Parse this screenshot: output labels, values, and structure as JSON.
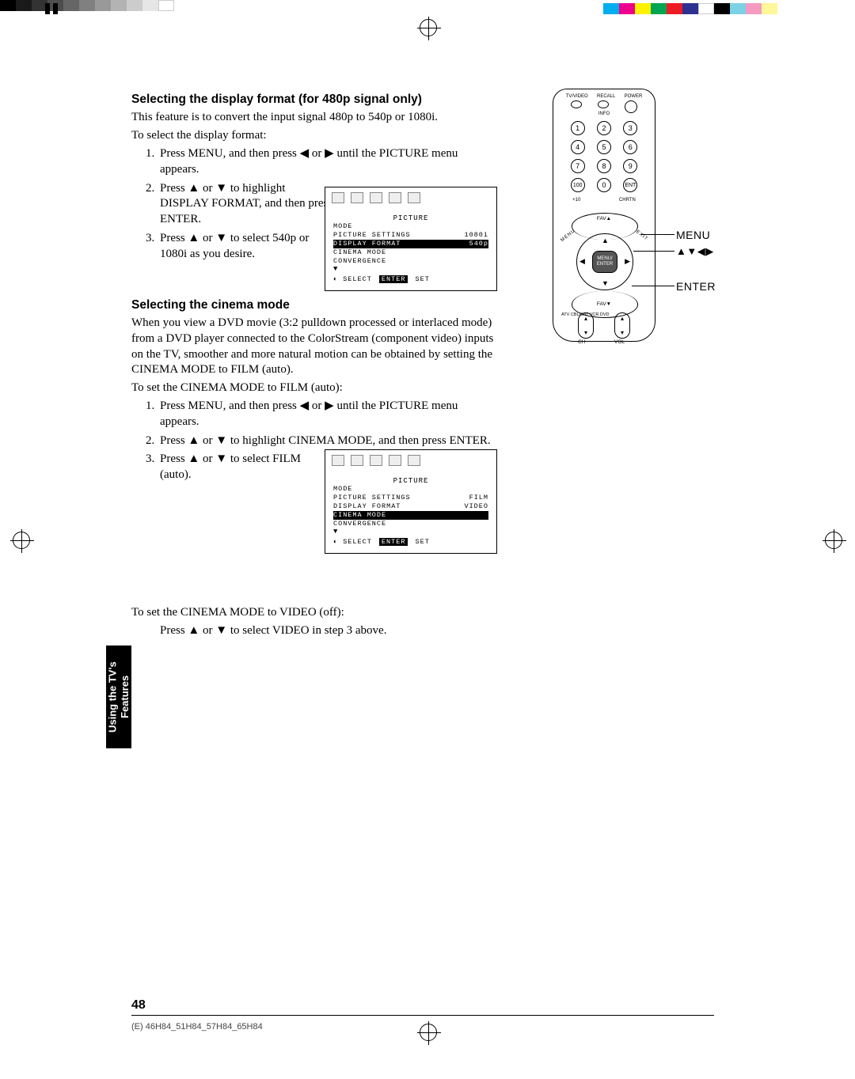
{
  "section1": {
    "heading": "Selecting the display format (for 480p signal only)",
    "intro": "This feature is to convert the input signal 480p to 540p or 1080i.",
    "lead": "To select the display format:",
    "step1": "Press MENU, and then press ◀ or ▶ until the PICTURE menu appears.",
    "step2": "Press ▲ or ▼ to highlight DISPLAY FORMAT, and then press ENTER.",
    "step3": "Press ▲ or ▼ to select 540p or 1080i as you desire."
  },
  "menubox1": {
    "title": "PICTURE",
    "rows": [
      {
        "label": "MODE",
        "value": ""
      },
      {
        "label": "PICTURE SETTINGS",
        "value": "1080i"
      },
      {
        "label": "DISPLAY FORMAT",
        "value": "540p"
      },
      {
        "label": "CINEMA MODE",
        "value": ""
      },
      {
        "label": "CONVERGENCE",
        "value": ""
      }
    ],
    "highlight_index": 2,
    "footer_select": "SELECT",
    "footer_enter": "ENTER",
    "footer_set": "SET"
  },
  "section2": {
    "heading": "Selecting the cinema mode",
    "intro": "When you view a DVD movie (3:2 pulldown processed or interlaced mode) from a DVD player connected to the ColorStream (component video) inputs on the TV, smoother and more natural motion can be obtained by setting the CINEMA MODE to FILM (auto).",
    "lead": "To set the CINEMA MODE to FILM (auto):",
    "step1": "Press MENU, and then press ◀ or ▶ until the PICTURE menu appears.",
    "step2": "Press ▲ or ▼ to highlight CINEMA MODE, and then press ENTER.",
    "step3": "Press ▲ or ▼ to select FILM (auto)."
  },
  "menubox2": {
    "title": "PICTURE",
    "rows": [
      {
        "label": "MODE",
        "value": ""
      },
      {
        "label": "PICTURE SETTINGS",
        "value": "FILM"
      },
      {
        "label": "DISPLAY FORMAT",
        "value": "VIDEO"
      },
      {
        "label": "CINEMA MODE",
        "value": ""
      },
      {
        "label": "CONVERGENCE",
        "value": ""
      }
    ],
    "highlight_index": 3,
    "footer_select": "SELECT",
    "footer_enter": "ENTER",
    "footer_set": "SET"
  },
  "section3": {
    "lead": "To set the CINEMA MODE to VIDEO (off):",
    "body": "Press ▲ or ▼ to select VIDEO in step 3 above."
  },
  "remote": {
    "topbar": [
      "TV/VIDEO",
      "RECALL",
      "POWER"
    ],
    "info": "INFO",
    "numbers": [
      "1",
      "2",
      "3",
      "4",
      "5",
      "6",
      "7",
      "8",
      "9",
      "100",
      "0",
      "ENT"
    ],
    "sub100": "+10",
    "subent": "CHRTN",
    "fava": "FAV▲",
    "favd": "FAV▼",
    "menu": "MENU",
    "exit": "EXIT",
    "center1": "MENU/",
    "center2": "ENTER",
    "ch": "CH",
    "vol": "VOL",
    "sidelist": "ATV\nCBL/SAT\nVCR\nDVD"
  },
  "callouts": {
    "menu": "MENU",
    "arrows": "▲▼◀▶",
    "enter": "ENTER"
  },
  "sidetab": "Using the TV's\nFeatures",
  "pagenum": "48",
  "footfile": "(E) 46H84_51H84_57H84_65H84"
}
